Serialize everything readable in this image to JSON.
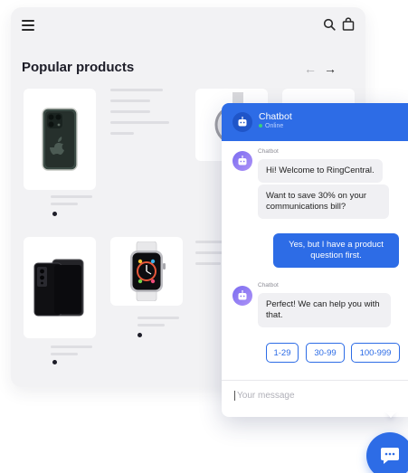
{
  "shop": {
    "title": "Popular products",
    "icons": {
      "menu": "menu-icon",
      "search": "search-icon",
      "bag": "shopping-bag-icon",
      "prev": "arrow-left-icon",
      "next": "arrow-right-icon"
    },
    "arrows": {
      "prev": "←",
      "next": "→"
    },
    "products": [
      "iphone-product",
      "watch-product-back",
      "samsung-phone-product",
      "apple-watch-product"
    ]
  },
  "chat": {
    "name": "Chatbot",
    "status": "Online",
    "messages": [
      {
        "sender": "Chatbot",
        "lines": [
          "Hi! Welcome to RingCentral.",
          "Want to save 30% on your communications bill?"
        ]
      },
      {
        "sender": "user",
        "text": "Yes, but I have a product question first."
      },
      {
        "sender": "Chatbot",
        "lines": [
          "Perfect! We can help you with that."
        ]
      }
    ],
    "quick_replies": [
      "1-29",
      "30-99",
      "100-999"
    ],
    "input_placeholder": "Your message"
  },
  "colors": {
    "accent": "#2d6ce6",
    "background": "#f2f2f4",
    "bot_bubble": "#f0f0f3"
  },
  "fab_icon": "chat-bubble-icon"
}
